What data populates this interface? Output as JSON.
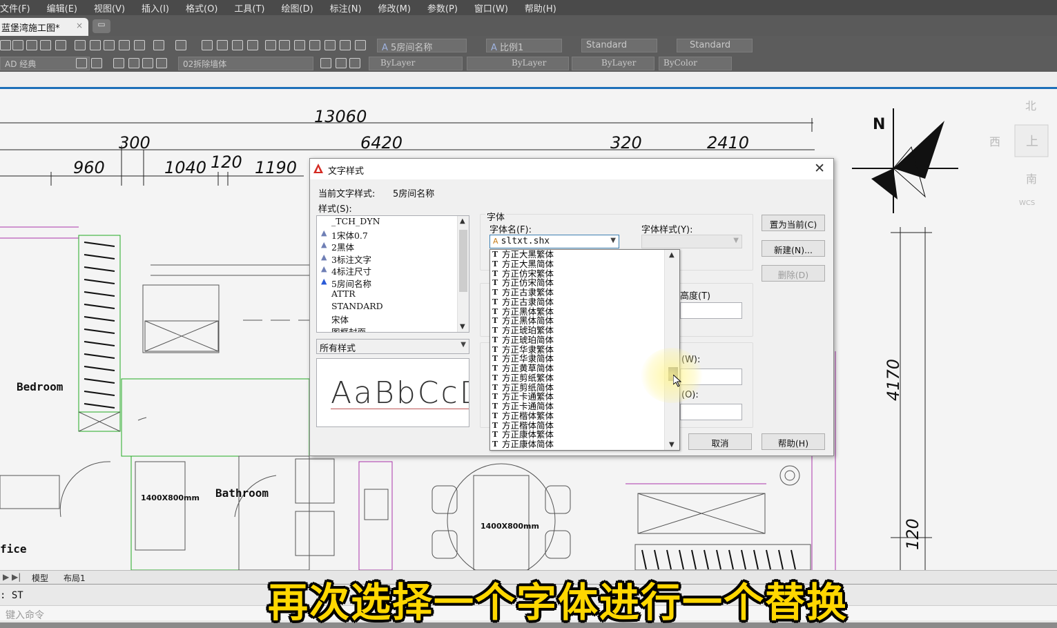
{
  "menu": [
    "文件(F)",
    "编辑(E)",
    "视图(V)",
    "插入(I)",
    "格式(O)",
    "工具(T)",
    "绘图(D)",
    "标注(N)",
    "修改(M)",
    "参数(P)",
    "窗口(W)",
    "帮助(H)"
  ],
  "doc_tab": {
    "title": "蓝堡湾施工图*",
    "close": "×"
  },
  "toolbar": {
    "text_style": "5房间名称",
    "dim_style": "比例1",
    "table_style": "Standard",
    "multileader_style": "Standard",
    "workspace": "AD 经典",
    "layer": "02拆除墙体",
    "color": "ByLayer",
    "linetype": "ByLayer",
    "lineweight": "ByLayer",
    "plotstyle": "ByColor"
  },
  "drawing": {
    "dims_top": [
      "13060"
    ],
    "dims_mid": [
      "300",
      "6420",
      "320",
      "2410"
    ],
    "dims_low": [
      "960",
      "1040",
      "120",
      "1190"
    ],
    "dims_right": [
      "4170",
      "120"
    ],
    "room_labels": [
      "Bedroom",
      "Bathroom",
      "fice"
    ],
    "size_labels": [
      "1400X800mm",
      "1400X800mm"
    ],
    "compass": "N",
    "viewcube": {
      "north": "北",
      "west": "西",
      "south": "南",
      "top": "上",
      "wcs": "WCS"
    }
  },
  "layout_tabs": [
    "模型",
    "布局1"
  ],
  "command": {
    "history": ": ST",
    "placeholder": "键入命令"
  },
  "subtitle": "再次选择一个字体进行一个替换",
  "dialog": {
    "title": "文字样式",
    "current_style_label": "当前文字样式:",
    "current_style_value": "5房间名称",
    "styles_label": "样式(S):",
    "styles": [
      {
        "name": "_TCH_DYN",
        "annotative": false
      },
      {
        "name": "1宋体0.7",
        "annotative": true
      },
      {
        "name": "2黑体",
        "annotative": true
      },
      {
        "name": "3标注文字",
        "annotative": true
      },
      {
        "name": "4标注尺寸",
        "annotative": true
      },
      {
        "name": "5房间名称",
        "annotative": true,
        "selected": true
      },
      {
        "name": "ATTR",
        "annotative": false
      },
      {
        "name": "STANDARD",
        "annotative": false
      },
      {
        "name": "宋体",
        "annotative": false
      },
      {
        "name": "图框封面",
        "annotative": false
      }
    ],
    "filter_value": "所有样式",
    "preview_text": "AaBbCcD",
    "font_group_label": "字体",
    "font_name_label": "字体名(F):",
    "font_name_value": "sltxt.shx",
    "font_style_label": "字体样式(Y):",
    "height_label": "高度(T)",
    "width_label": "(W):",
    "oblique_label": "(O):",
    "buttons": {
      "set_current": "置为当前(C)",
      "new": "新建(N)...",
      "delete": "删除(D)",
      "cancel": "取消",
      "help": "帮助(H)"
    },
    "font_options": [
      "方正大黑繁体",
      "方正大黑简体",
      "方正仿宋繁体",
      "方正仿宋简体",
      "方正古隶繁体",
      "方正古隶简体",
      "方正黑体繁体",
      "方正黑体简体",
      "方正琥珀繁体",
      "方正琥珀简体",
      "方正华隶繁体",
      "方正华隶简体",
      "方正黄草简体",
      "方正剪纸繁体",
      "方正剪纸简体",
      "方正卡通繁体",
      "方正卡通简体",
      "方正楷体繁体",
      "方正楷体简体",
      "方正康体繁体",
      "方正康体简体"
    ]
  },
  "colors": {
    "accent_blue": "#1d6fb8",
    "subtitle_yellow": "#ffd700",
    "wall_green": "#33bb33",
    "wall_purple": "#b04ab0"
  }
}
